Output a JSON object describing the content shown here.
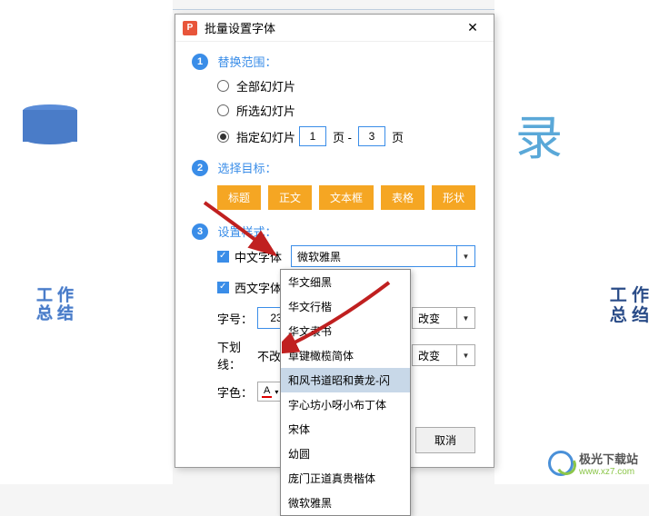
{
  "dialog": {
    "title": "批量设置字体",
    "section1": {
      "title": "替换范围：",
      "radio1": "全部幻灯片",
      "radio2": "所选幻灯片",
      "radio3_prefix": "指定幻灯片",
      "from_val": "1",
      "page_label1": "页 -",
      "to_val": "3",
      "page_label2": "页"
    },
    "section2": {
      "title": "选择目标：",
      "t1": "标题",
      "t2": "正文",
      "t3": "文本框",
      "t4": "表格",
      "t5": "形状"
    },
    "section3": {
      "title": "设置样式：",
      "cnfont_lbl": "中文字体",
      "cn_font_val": "微软雅黑",
      "en_font_lbl": "西文字体",
      "size_lbl": "字号：",
      "size_val": "23",
      "size_sel": "改变",
      "underline_lbl": "下划线：",
      "underline_val": "不改",
      "underline_sel": "改变",
      "color_lbl": "字色：",
      "color_a": "A"
    },
    "cancel": "取消"
  },
  "dropdown": {
    "i0": "华文细黑",
    "i1": "华文行楷",
    "i2": "华文隶书",
    "i3": "卓键橄榄简体",
    "i4": "和风书道昭和黄龙-闪",
    "i5": "字心坊小呀小布丁体",
    "i6": "宋体",
    "i7": "幼圆",
    "i8": "庞门正道真贵楷体",
    "i9": "微软雅黑"
  },
  "bg": {
    "work": "工作\n总结",
    "work2": "工 作\n总 绉",
    "lu": "录"
  },
  "wm": {
    "name": "极光下载站",
    "url": "www.xz7.com"
  }
}
